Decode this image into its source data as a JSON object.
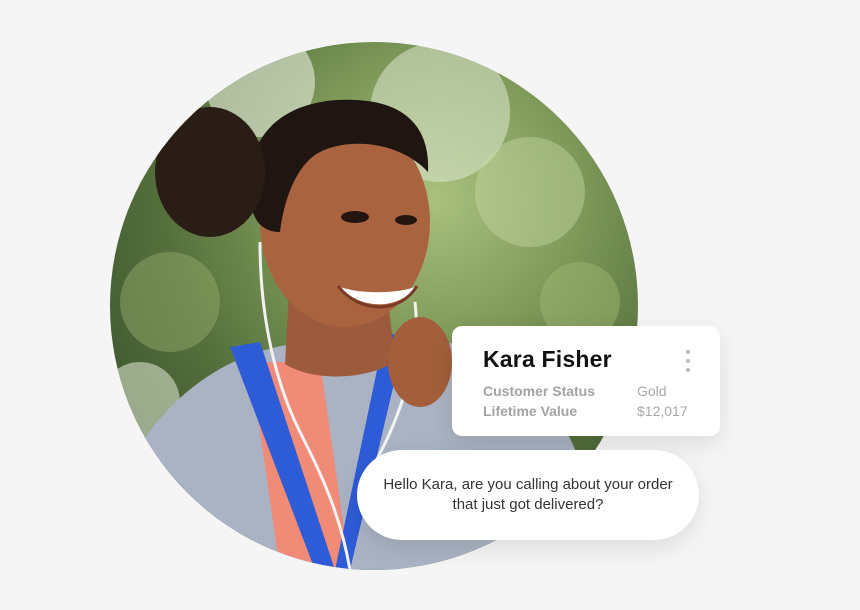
{
  "photo": {
    "subject": "smiling woman with earphones"
  },
  "customer_card": {
    "name": "Kara Fisher",
    "menu_icon": "more-vertical-icon",
    "rows": [
      {
        "label": "Customer Status",
        "value": "Gold"
      },
      {
        "label": "Lifetime Value",
        "value": "$12,017"
      }
    ]
  },
  "chat": {
    "message": "Hello Kara, are you calling about your order that just got delivered?"
  },
  "colors": {
    "background": "#f5f5f5",
    "card": "#ffffff",
    "name_text": "#111111",
    "muted_text": "#a3a3a3",
    "jacket": "#a9b3c4",
    "jacket_trim": "#2d5bd6",
    "shirt": "#f08a78"
  }
}
